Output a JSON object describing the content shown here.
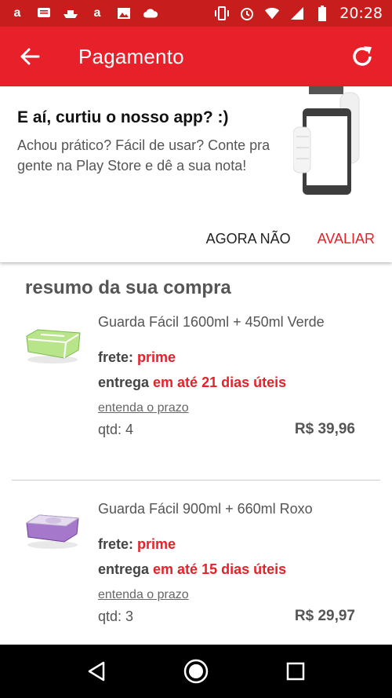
{
  "status_bar": {
    "time": "20:28",
    "left_icons": [
      "amazon-a-icon",
      "message-icon",
      "ship-icon",
      "amazon-a-icon",
      "image-icon",
      "cloud-icon"
    ],
    "right_icons": [
      "vibrate-icon",
      "alarm-icon",
      "wifi-icon",
      "signal-icon",
      "battery-icon"
    ]
  },
  "app_bar": {
    "title": "Pagamento"
  },
  "rate_card": {
    "title": "E aí, curtiu o nosso app? :)",
    "text": "Achou prático? Fácil de usar? Conte pra gente na Play Store e dê a sua nota!",
    "later_label": "AGORA NÃO",
    "rate_label": "AVALIAR"
  },
  "summary": {
    "title": "resumo da sua compra",
    "items": [
      {
        "name": "Guarda Fácil 1600ml + 450ml Verde",
        "frete_label": "frete: ",
        "frete_value": "prime",
        "entrega_label": "entrega ",
        "entrega_value": "em até 21 dias úteis",
        "prazo_link": "entenda o prazo",
        "qtd": "qtd: 4",
        "price": "R$ 39,96",
        "color": "#9ed86a"
      },
      {
        "name": "Guarda Fácil 900ml + 660ml Roxo",
        "frete_label": "frete: ",
        "frete_value": "prime",
        "entrega_label": "entrega ",
        "entrega_value": "em até 15 dias úteis",
        "prazo_link": "entenda o prazo",
        "qtd": "qtd: 3",
        "price": "R$ 29,97",
        "color": "#8e5bb5"
      }
    ]
  },
  "colors": {
    "status_bar": "#c81d1d",
    "app_bar": "#e8202a",
    "accent": "#e8202a"
  }
}
